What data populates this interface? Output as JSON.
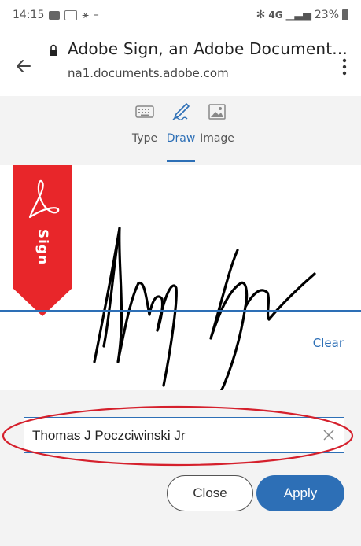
{
  "status_bar": {
    "time": "14:15",
    "network": "4G",
    "battery": "23%"
  },
  "url_bar": {
    "title": "Adobe Sign, an Adobe Document...",
    "url": "na1.documents.adobe.com"
  },
  "signature_tabs": [
    {
      "label": "Type",
      "icon": "keyboard-icon",
      "active": false
    },
    {
      "label": "Draw",
      "icon": "pen-icon",
      "active": true
    },
    {
      "label": "Image",
      "icon": "image-icon",
      "active": false
    }
  ],
  "sign_flag": {
    "label": "Sign",
    "color": "#e8262a"
  },
  "draw_area": {
    "clear_label": "Clear"
  },
  "name_field": {
    "value": "Thomas J Poczciwinski Jr"
  },
  "buttons": {
    "close_label": "Close",
    "apply_label": "Apply"
  },
  "colors": {
    "accent": "#2d6fb6",
    "highlight": "#d5202c",
    "flag": "#e8262a"
  }
}
